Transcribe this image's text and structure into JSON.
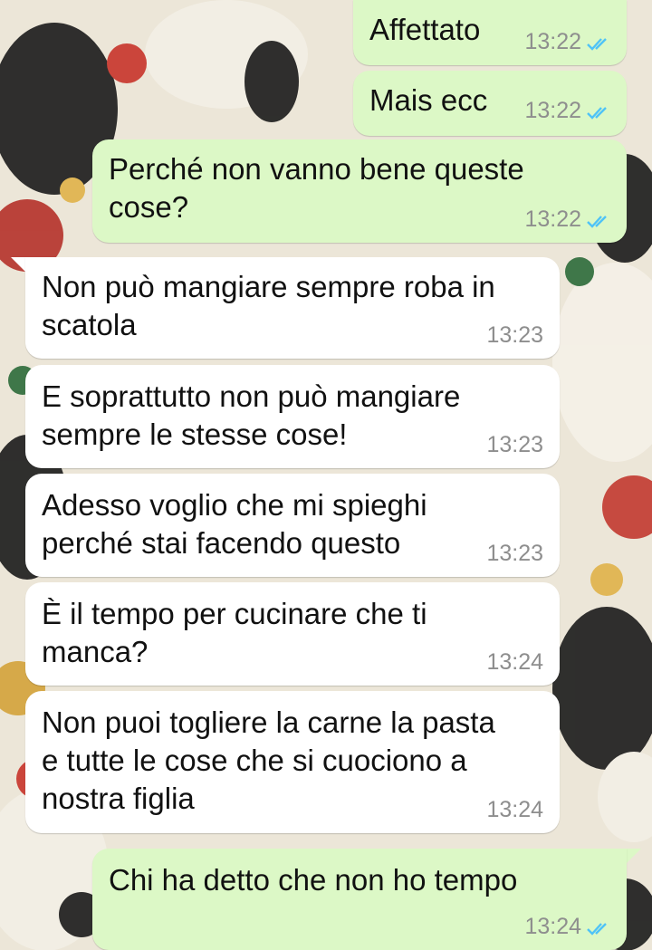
{
  "colors": {
    "outgoing_bubble": "#dcf8c6",
    "incoming_bubble": "#ffffff",
    "read_ticks": "#4fc3f7",
    "timestamp": "#8e8e8e"
  },
  "messages": [
    {
      "direction": "outgoing",
      "lines": [
        "Affettato"
      ],
      "time": "13:22",
      "status": "read"
    },
    {
      "direction": "outgoing",
      "lines": [
        "Mais ecc"
      ],
      "time": "13:22",
      "status": "read"
    },
    {
      "direction": "outgoing",
      "lines": [
        "Perché non vanno bene queste",
        "cose?"
      ],
      "time": "13:22",
      "status": "read"
    },
    {
      "direction": "incoming",
      "lines": [
        "Non può mangiare sempre roba in",
        "scatola"
      ],
      "time": "13:23"
    },
    {
      "direction": "incoming",
      "lines": [
        "E soprattutto non può mangiare",
        "sempre le stesse cose!"
      ],
      "time": "13:23"
    },
    {
      "direction": "incoming",
      "lines": [
        "Adesso voglio che mi spieghi",
        "perché stai facendo questo"
      ],
      "time": "13:23"
    },
    {
      "direction": "incoming",
      "lines": [
        "È il tempo per cucinare che ti",
        "manca?"
      ],
      "time": "13:24"
    },
    {
      "direction": "incoming",
      "lines": [
        "Non puoi togliere la carne la pasta",
        "e tutte le cose che si cuociono a",
        "nostra figlia"
      ],
      "time": "13:24"
    },
    {
      "direction": "outgoing",
      "lines": [
        "Chi ha detto che non ho tempo"
      ],
      "time": "13:24",
      "status": "read"
    }
  ]
}
